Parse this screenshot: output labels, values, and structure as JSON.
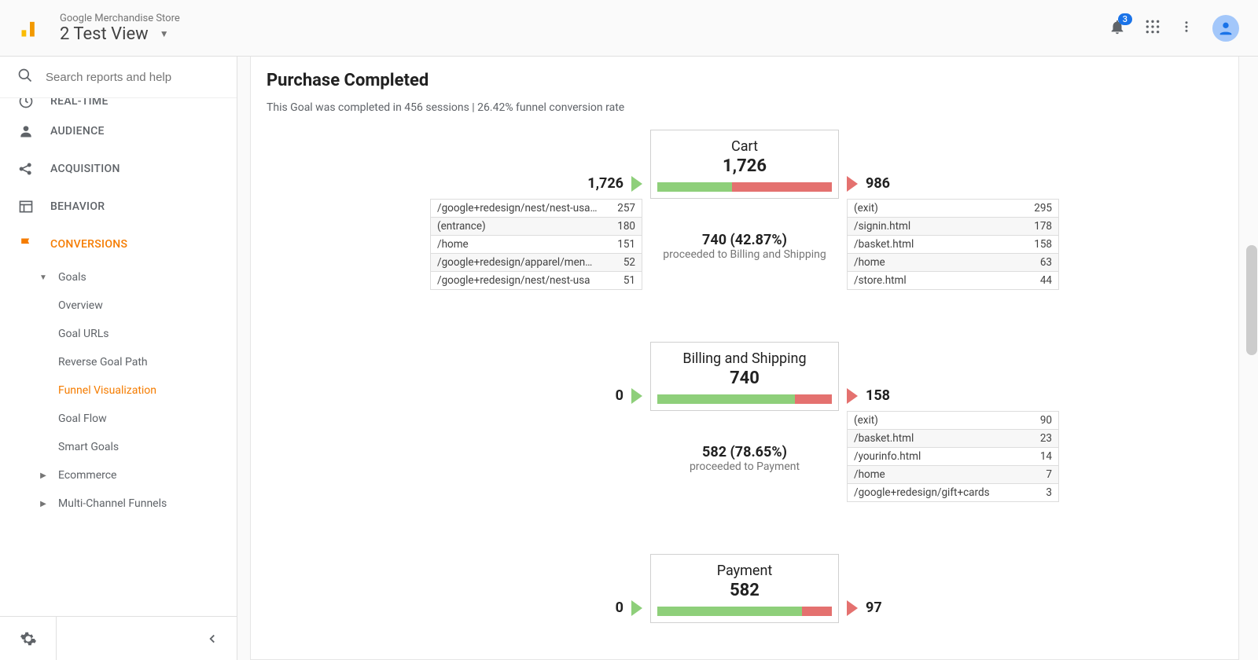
{
  "header": {
    "account": "Google Merchandise Store",
    "view": "2 Test View",
    "notifications": "3"
  },
  "search": {
    "placeholder": "Search reports and help"
  },
  "nav": {
    "realtime": "REAL-TIME",
    "audience": "AUDIENCE",
    "acquisition": "ACQUISITION",
    "behavior": "BEHAVIOR",
    "conversions": "CONVERSIONS",
    "goals": "Goals",
    "overview": "Overview",
    "goal_urls": "Goal URLs",
    "reverse": "Reverse Goal Path",
    "funnel_viz": "Funnel Visualization",
    "goal_flow": "Goal Flow",
    "smart_goals": "Smart Goals",
    "ecommerce": "Ecommerce",
    "multichannel": "Multi-Channel Funnels"
  },
  "report": {
    "title": "Purchase Completed",
    "subtitle": "This Goal was completed in 456 sessions | 26.42% funnel conversion rate"
  },
  "chart_data": {
    "type": "funnel",
    "steps": [
      {
        "name": "Cart",
        "count": "1,726",
        "in_count": "1,726",
        "out_count": "986",
        "proceed_count": "740",
        "proceed_pct": "42.87%",
        "proceed_label": "proceeded to Billing and Shipping",
        "bar_pass": 43,
        "in_paths": [
          {
            "path": "/google+redesign/nest/nest-usa…",
            "val": "257"
          },
          {
            "path": "(entrance)",
            "val": "180"
          },
          {
            "path": "/home",
            "val": "151"
          },
          {
            "path": "/google+redesign/apparel/men…",
            "val": "52"
          },
          {
            "path": "/google+redesign/nest/nest-usa",
            "val": "51"
          }
        ],
        "out_paths": [
          {
            "path": "(exit)",
            "val": "295"
          },
          {
            "path": "/signin.html",
            "val": "178"
          },
          {
            "path": "/basket.html",
            "val": "158"
          },
          {
            "path": "/home",
            "val": "63"
          },
          {
            "path": "/store.html",
            "val": "44"
          }
        ]
      },
      {
        "name": "Billing and Shipping",
        "count": "740",
        "in_count": "0",
        "out_count": "158",
        "proceed_count": "582",
        "proceed_pct": "78.65%",
        "proceed_label": "proceeded to Payment",
        "bar_pass": 79,
        "in_paths": [],
        "out_paths": [
          {
            "path": "(exit)",
            "val": "90"
          },
          {
            "path": "/basket.html",
            "val": "23"
          },
          {
            "path": "/yourinfo.html",
            "val": "14"
          },
          {
            "path": "/home",
            "val": "7"
          },
          {
            "path": "/google+redesign/gift+cards",
            "val": "3"
          }
        ]
      },
      {
        "name": "Payment",
        "count": "582",
        "in_count": "0",
        "out_count": "97",
        "proceed_count": "",
        "proceed_pct": "",
        "proceed_label": "",
        "bar_pass": 83,
        "in_paths": [],
        "out_paths": []
      }
    ]
  }
}
